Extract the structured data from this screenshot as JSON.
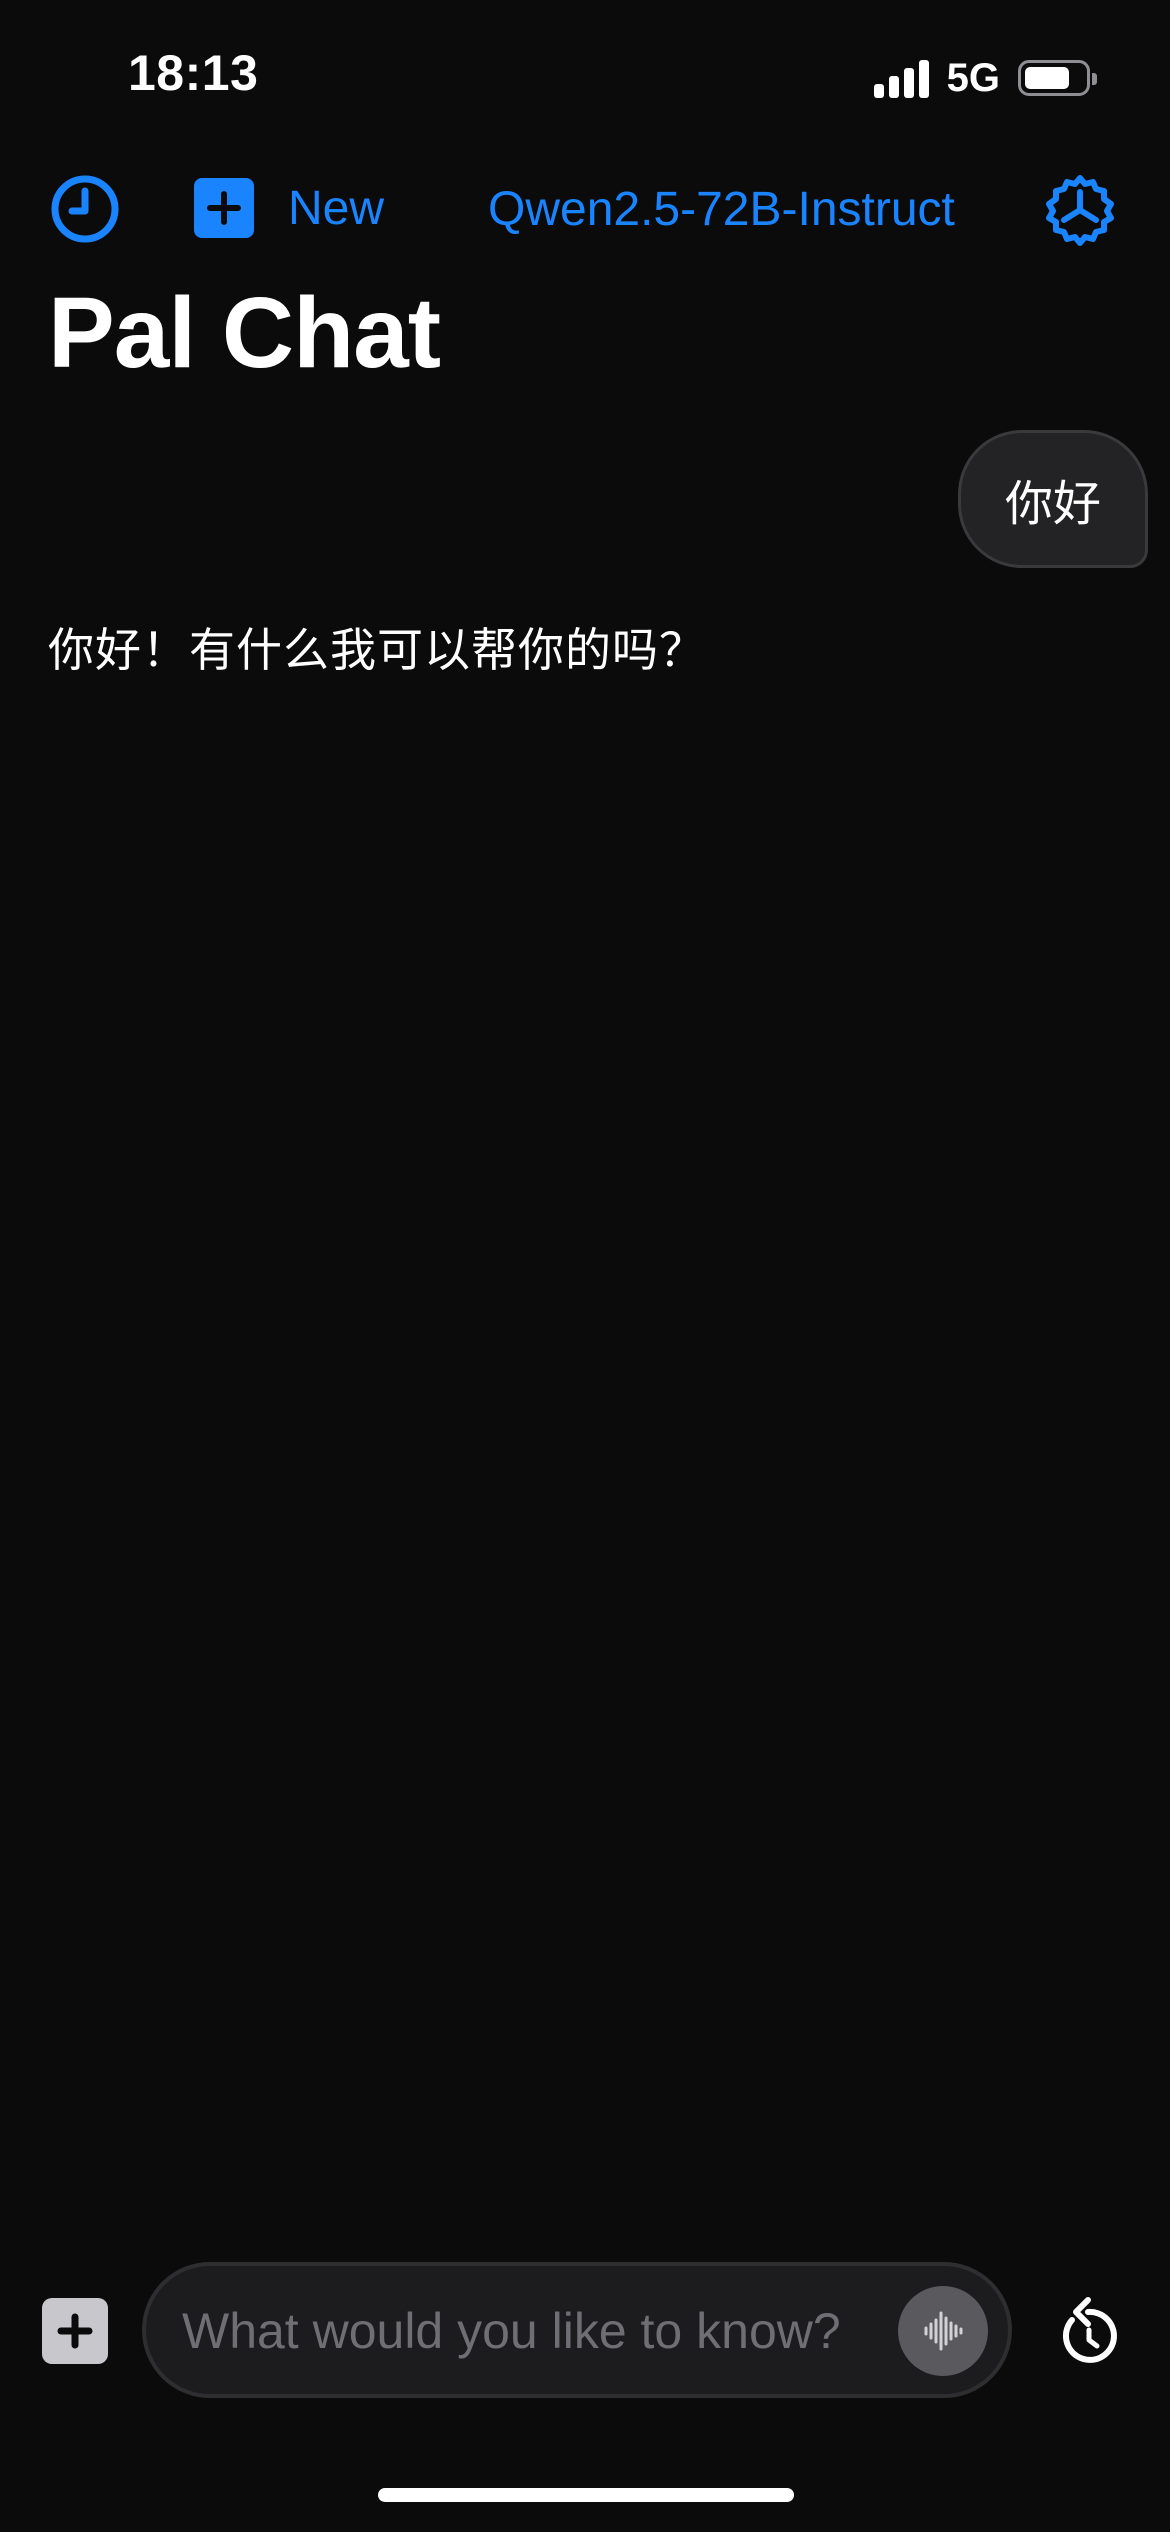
{
  "status_bar": {
    "time": "18:13",
    "network": "5G",
    "icons": [
      "signal-icon",
      "battery-icon"
    ]
  },
  "nav": {
    "history_icon": "clock-icon",
    "new_icon": "plus-square-icon",
    "new_label": "New",
    "model_label": "Qwen2.5-72B-Instruct",
    "settings_icon": "gear-icon"
  },
  "page": {
    "title": "Pal Chat"
  },
  "messages": [
    {
      "role": "user",
      "text": "你好"
    },
    {
      "role": "assistant",
      "text": "你好！有什么我可以帮你的吗？"
    }
  ],
  "composer": {
    "attach_icon": "plus-square-icon",
    "placeholder": "What would you like to know?",
    "value": "",
    "voice_icon": "waveform-icon",
    "reset_icon": "rotate-ccw-icon"
  },
  "colors": {
    "background": "#0b0b0c",
    "accent": "#1a84ff",
    "bubble": "#232325",
    "input_bg": "#1c1c1e"
  }
}
